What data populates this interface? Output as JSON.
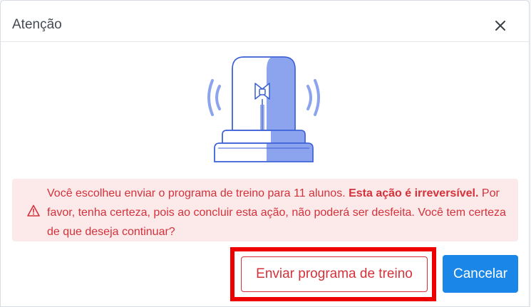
{
  "modal": {
    "title": "Atenção"
  },
  "alert": {
    "text_normal": "Você escolheu enviar o programa de treino para 11 alunos. ",
    "text_bold": "Esta ação é irreversível.",
    "text_rest": " Por favor, tenha certeza, pois ao concluir esta ação, não poderá ser desfeita. Você tem certeza de que deseja continuar?"
  },
  "buttons": {
    "send_label": "Enviar programa de treino",
    "cancel_label": "Cancelar"
  },
  "icons": {
    "close": "close-icon",
    "warning": "warning-triangle-icon",
    "illustration": "siren-alarm-icon"
  },
  "colors": {
    "danger": "#d3323a",
    "danger_bg": "#fce9ea",
    "primary": "#1a87e8",
    "illustration_fill": "#8ca3ee",
    "illustration_stroke": "#3a5fd6",
    "highlight": "#ee0000"
  }
}
